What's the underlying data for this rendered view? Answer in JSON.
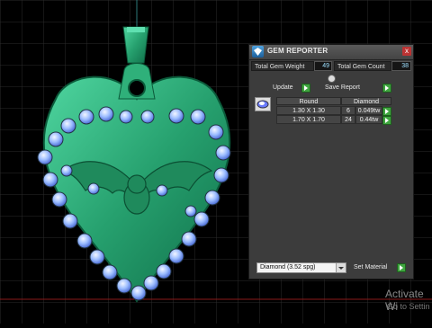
{
  "panel": {
    "title": "GEM REPORTER",
    "close_label": "x",
    "total_gem_weight_label": "Total Gem Weight",
    "total_gem_weight_value": "49",
    "total_gem_count_label": "Total Gem Count",
    "total_gem_count_value": "38",
    "update_label": "Update",
    "save_report_label": "Save Report",
    "table": {
      "columns": [
        "Round",
        "Diamond"
      ],
      "rows": [
        {
          "size": "1.30 X 1.30",
          "count": "6",
          "weight": "0.049tw"
        },
        {
          "size": "1.70 X 1.70",
          "count": "24",
          "weight": "0.44tw"
        }
      ]
    },
    "material_select": "Diamond    (3.52 spg)",
    "set_material_label": "Set Material"
  },
  "watermark": {
    "line1": "Activate Wi",
    "line2": "Go to Settin"
  },
  "colors": {
    "pendant": "#2fae7a",
    "gem": "#8fb8ff",
    "grid": "#2a2a2a",
    "axis_red": "#7a1010"
  }
}
